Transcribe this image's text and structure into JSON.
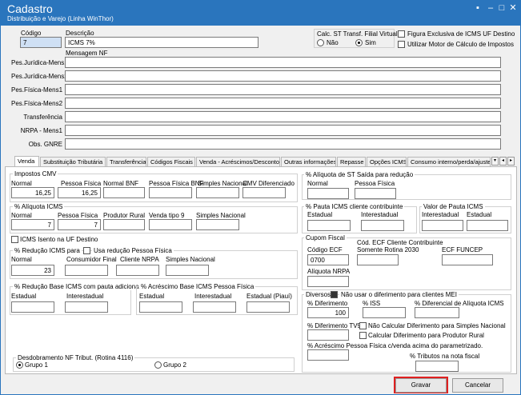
{
  "window": {
    "title": "Cadastro",
    "subtitle": "Distribuição e Varejo (Linha WinThor)",
    "btn_restore": "▪",
    "btn_min": "–",
    "btn_max": "□",
    "btn_close": "✕"
  },
  "header": {
    "codigo_label": "Código",
    "codigo_value": "7",
    "descricao_label": "Descrição",
    "descricao_value": "ICMS 7%",
    "mensagem_nf_label": "Mensagem NF",
    "calc_st_label": "Calc. ST Transf. Filial Virtual",
    "nao_label": "Não",
    "sim_label": "Sim",
    "exclusiva_label": "Figura Exclusiva de ICMS UF Destino",
    "motor_label": "Utilizar Motor de Cálculo de Impostos"
  },
  "mensagens": [
    {
      "label": "Pes.Jurídica-Mens1",
      "value": ""
    },
    {
      "label": "Pes.Jurídica-Mens2",
      "value": ""
    },
    {
      "label": "Pes.Física-Mens1",
      "value": ""
    },
    {
      "label": "Pes.Física-Mens2",
      "value": ""
    },
    {
      "label": "Transferência",
      "value": ""
    },
    {
      "label": "NRPA - Mens1",
      "value": ""
    },
    {
      "label": "Obs. GNRE",
      "value": ""
    }
  ],
  "tabs": [
    "Venda",
    "Substituição Tributária",
    "Transferência",
    "Códigos Fiscais",
    "Venda - Acréscimos/Descontos",
    "Outras informações",
    "Repasse",
    "Opções ICMS",
    "Consumo interno/perda/ajuste"
  ],
  "impostos_cmv": {
    "title": "Impostos CMV",
    "cols": [
      "Normal",
      "Pessoa Física",
      "Normal BNF",
      "Pessoa Física BNF",
      "Simples Nacional",
      "CMV Diferenciado"
    ],
    "values": [
      "16,25",
      "16,25",
      "",
      "",
      "",
      ""
    ]
  },
  "aliquota_icms": {
    "title": "% Alíquota ICMS",
    "cols": [
      "Normal",
      "Pessoa Física",
      "Produtor Rural",
      "Venda tipo 9",
      "Simples Nacional"
    ],
    "values": [
      "7",
      "7",
      "",
      "",
      ""
    ]
  },
  "icms_isento_label": "ICMS Isento na UF Destino",
  "reducao_icms": {
    "title": "% Redução ICMS para",
    "usa_label": "Usa redução Pessoa Física",
    "cols": [
      "Normal",
      "Consumidor Final",
      "Cliente NRPA",
      "Simples Nacional"
    ],
    "values": [
      "23",
      "",
      "",
      ""
    ]
  },
  "reducao_base": {
    "title": "% Redução Base ICMS com pauta adicionais",
    "cols": [
      "Estadual",
      "Interestadual"
    ]
  },
  "acrescimo_base": {
    "title": "% Acréscimo Base ICMS Pessoa Física",
    "cols": [
      "Estadual",
      "Interestadual",
      "Estadual (Piauí)"
    ]
  },
  "desdobramento": {
    "title": "Desdobramento NF Tribut. (Rotina 4116)",
    "grupo1": "Grupo 1",
    "grupo2": "Grupo 2"
  },
  "aliquota_st": {
    "title": "% Alíquota de ST Saída para redução",
    "cols": [
      "Normal",
      "Pessoa Física"
    ]
  },
  "pauta_icms": {
    "title": "% Pauta ICMS cliente contribuinte",
    "cols": [
      "Estadual",
      "Interestadual"
    ]
  },
  "valor_pauta": {
    "title": "Valor de Pauta ICMS",
    "cols": [
      "Interestadual",
      "Estadual"
    ]
  },
  "cupom_fiscal": {
    "title": "Cupom Fiscal",
    "codigo_ecf_label": "Código ECF",
    "codigo_ecf_value": "0700",
    "cod_ecf_cliente_label1": "Cód. ECF Cliente Contribuinte",
    "cod_ecf_cliente_label2": "Somente Rotina 2030",
    "ecf_funcep_label": "ECF FUNCEP",
    "aliquota_nrpa_label": "Alíquota NRPA"
  },
  "diversos": {
    "title": "Diversos",
    "nao_usar_label": "Não usar o diferimento para clientes MEI",
    "diferimento_label": "% Diferimento",
    "diferimento_value": "100",
    "iss_label": "% ISS",
    "dif_aliquota_label": "% Diferencial de Alíquota ICMS",
    "diferimento_tv9_label": "% Diferimento TV9",
    "nao_calcular_label": "Não Calcular Diferimento para Simples Nacional",
    "calcular_rural_label": "Calcular Diferimento para Produtor Rural",
    "acrescimo_pf_label": "% Acréscimo Pessoa Física c/venda acima do parametrizado.",
    "tributos_label": "% Tributos na nota fiscal"
  },
  "buttons": {
    "gravar": "Gravar",
    "cancelar": "Cancelar"
  },
  "colors": {
    "titlebar": "#2a75bd",
    "highlight": "#e02020"
  }
}
